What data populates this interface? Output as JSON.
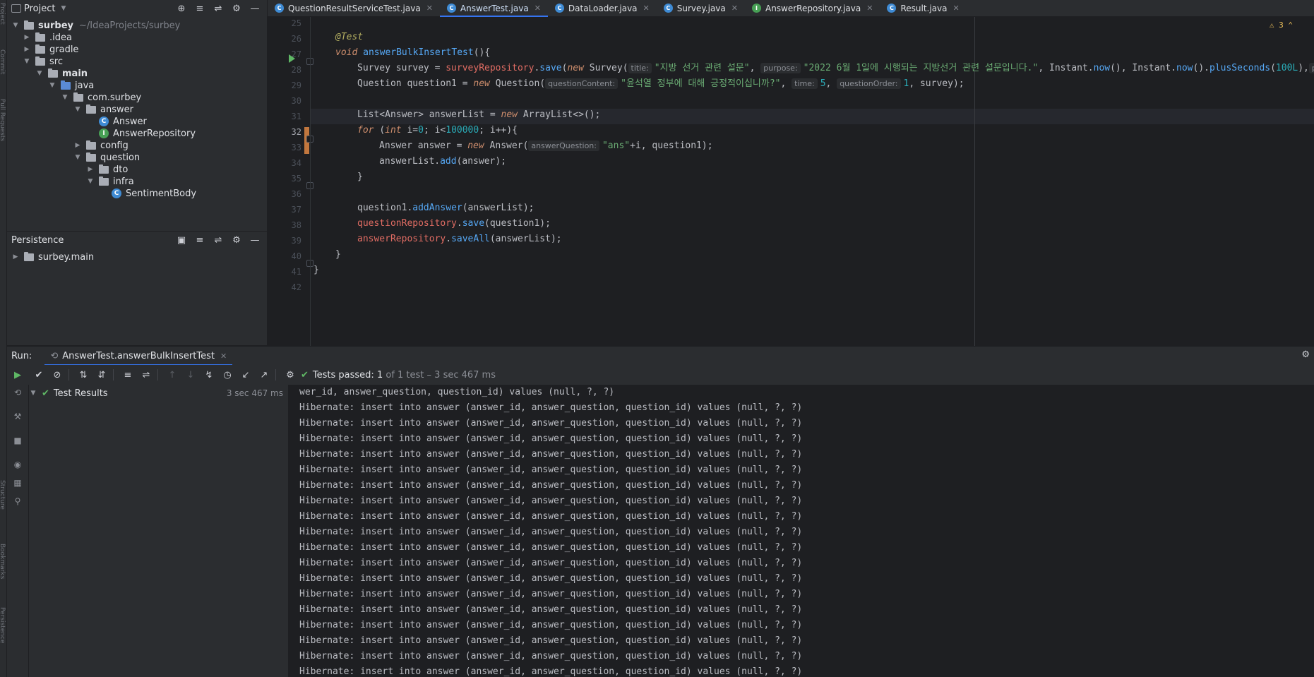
{
  "left_strip": {
    "items": [
      "Project",
      "Commit",
      "Pull Requests",
      "Structure",
      "Bookmarks",
      "Persistence"
    ]
  },
  "project_panel": {
    "title": "Project",
    "tree": [
      {
        "label": "surbey",
        "hint": "~/IdeaProjects/surbey",
        "kind": "root"
      },
      {
        "label": ".idea",
        "kind": "folder"
      },
      {
        "label": "gradle",
        "kind": "folder"
      },
      {
        "label": "src",
        "kind": "folder"
      },
      {
        "label": "main",
        "kind": "folder"
      },
      {
        "label": "java",
        "kind": "src-folder"
      },
      {
        "label": "com.surbey",
        "kind": "package"
      },
      {
        "label": "answer",
        "kind": "package"
      },
      {
        "label": "Answer",
        "kind": "class"
      },
      {
        "label": "AnswerRepository",
        "kind": "interface"
      },
      {
        "label": "config",
        "kind": "package"
      },
      {
        "label": "question",
        "kind": "package"
      },
      {
        "label": "dto",
        "kind": "package"
      },
      {
        "label": "infra",
        "kind": "package"
      },
      {
        "label": "SentimentBody",
        "kind": "class"
      }
    ]
  },
  "persistence_panel": {
    "title": "Persistence",
    "items": [
      "surbey.main"
    ]
  },
  "tabs": [
    {
      "label": "QuestionResultServiceTest.java",
      "icon": "test-class-icon",
      "active": false
    },
    {
      "label": "AnswerTest.java",
      "icon": "test-class-icon",
      "active": true
    },
    {
      "label": "DataLoader.java",
      "icon": "class-icon",
      "active": false
    },
    {
      "label": "Survey.java",
      "icon": "class-icon",
      "active": false
    },
    {
      "label": "AnswerRepository.java",
      "icon": "interface-icon",
      "active": false
    },
    {
      "label": "Result.java",
      "icon": "class-icon",
      "active": false
    }
  ],
  "editor": {
    "line_numbers": [
      "25",
      "26",
      "27",
      "28",
      "29",
      "30",
      "31",
      "32",
      "33",
      "34",
      "35",
      "36",
      "37",
      "38",
      "39",
      "40",
      "41",
      "42"
    ],
    "current_line": "32",
    "warnings": "3",
    "code": {
      "l26_ann": "@Test",
      "l27_void": "void ",
      "l27_fn": "answerBulkInsertTest",
      "l27_rest": "(){",
      "l28_a": "Survey survey = ",
      "l28_b": "surveyRepository",
      "l28_c": ".",
      "l28_d": "save",
      "l28_e": "(",
      "l28_f": "new ",
      "l28_g": "Survey(",
      "l28_hint1": "title:",
      "l28_s1": "\"지방 선거 관련 설문\"",
      "l28_h": ", ",
      "l28_hint2": "purpose:",
      "l28_s2": "\"2022 6월 1일에 시행되는 지방선거 관련 설문입니다.\"",
      "l28_i": ", Instant.",
      "l28_j": "now",
      "l28_k": "(), Instant.",
      "l28_l": "now",
      "l28_m": "().",
      "l28_n": "plusSeconds",
      "l28_o": "(",
      "l28_p": "100L",
      "l28_q": "),",
      "l28_hint3": "pa",
      "l29_a": "Question question1 = ",
      "l29_b": "new ",
      "l29_c": "Question(",
      "l29_hint1": "questionContent:",
      "l29_s1": "\"윤석열 정부에 대해 긍정적이십니까?\"",
      "l29_d": ", ",
      "l29_hint2": "time:",
      "l29_n1": "5",
      "l29_e": ", ",
      "l29_hint3": "questionOrder:",
      "l29_n2": "1",
      "l29_f": ", survey);",
      "l31_a": "List<Answer> answerList = ",
      "l31_b": "new ",
      "l31_c": "ArrayList<>();",
      "l32_a": "for ",
      "l32_b": "(",
      "l32_c": "int ",
      "l32_d": "i=",
      "l32_e": "0",
      "l32_f": "; i<",
      "l32_g": "100000",
      "l32_h": "; i++){",
      "l33_a": "Answer answer = ",
      "l33_b": "new ",
      "l33_c": "Answer(",
      "l33_hint": "answerQuestion:",
      "l33_s": "\"ans\"",
      "l33_d": "+i, question1);",
      "l34_a": "answerList.",
      "l34_b": "add",
      "l34_c": "(answer);",
      "l35": "}",
      "l37_a": "question1.",
      "l37_b": "addAnswer",
      "l37_c": "(answerList);",
      "l38_a": "questionRepository",
      "l38_b": ".",
      "l38_c": "save",
      "l38_d": "(question1);",
      "l39_a": "answerRepository",
      "l39_b": ".",
      "l39_c": "saveAll",
      "l39_d": "(answerList);",
      "l40": "}",
      "l41": "}"
    }
  },
  "run_panel": {
    "label": "Run:",
    "tab": "AnswerTest.answerBulkInsertTest",
    "status_prefix": "Tests passed: ",
    "status_count": "1",
    "status_rest": " of 1 test – 3 sec 467 ms",
    "test_results_label": "Test Results",
    "test_results_time": "3 sec 467 ms",
    "console_first": "wer_id, answer_question, question_id) values (null, ?, ?)",
    "console_line": "Hibernate: insert into answer (answer_id, answer_question, question_id) values (null, ?, ?)"
  }
}
